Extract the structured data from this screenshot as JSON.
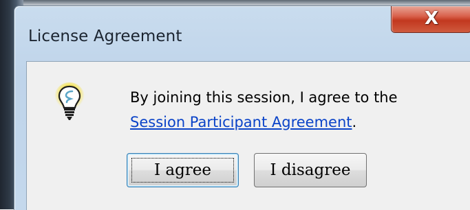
{
  "dialog": {
    "title": "License Agreement",
    "close_glyph": "X",
    "icon": "lightbulb-icon",
    "message_line1": "By joining this session, I agree to the",
    "link_text": "Session Participant Agreement",
    "link_suffix": ".",
    "buttons": {
      "agree_label": "I agree",
      "disagree_label": "I disagree"
    }
  },
  "colors": {
    "link": "#0a43c8",
    "close_button": "#c2381f",
    "titlebar": "#c4d8ec"
  }
}
